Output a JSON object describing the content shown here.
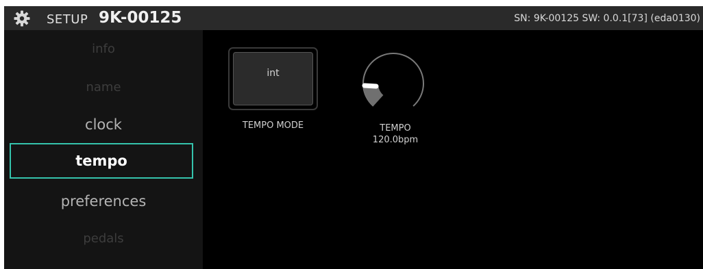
{
  "header": {
    "section": "SETUP",
    "device_name": "9K-00125",
    "info": "SN: 9K-00125 SW: 0.0.1[73] (eda0130)",
    "icon": "gear-icon"
  },
  "sidebar": {
    "items": [
      {
        "label": "info"
      },
      {
        "label": "name"
      },
      {
        "label": "clock"
      },
      {
        "label": "tempo"
      },
      {
        "label": "preferences"
      },
      {
        "label": "pedals"
      }
    ],
    "active": "tempo"
  },
  "main": {
    "tempo_mode": {
      "value": "int",
      "label": "TEMPO MODE"
    },
    "tempo": {
      "label": "TEMPO",
      "value_text": "120.0bpm"
    }
  },
  "colors": {
    "accent": "#35c4ad",
    "background": "#000000",
    "header": "#2a2a2a",
    "sidebar": "#141414"
  }
}
